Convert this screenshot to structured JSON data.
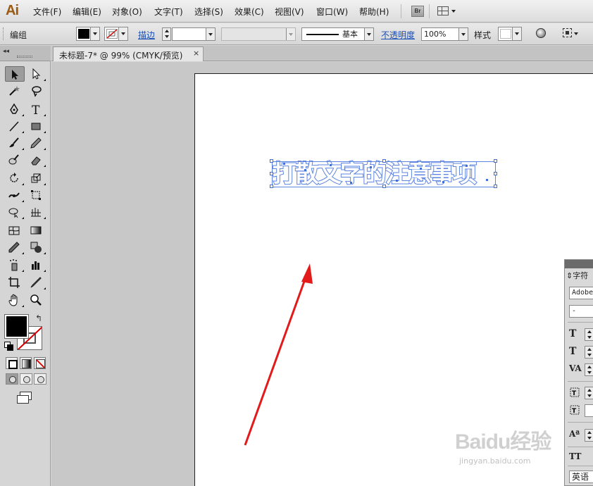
{
  "app": {
    "logo": "Ai",
    "menu": [
      "文件(F)",
      "编辑(E)",
      "对象(O)",
      "文字(T)",
      "选择(S)",
      "效果(C)",
      "视图(V)",
      "窗口(W)",
      "帮助(H)"
    ],
    "bridge_label": "Br"
  },
  "control_bar": {
    "selection_label": "编组",
    "fill_color": "#000000",
    "stroke_label": "描边",
    "stroke_weight": "",
    "stroke_profile": "基本",
    "opacity_label": "不透明度",
    "opacity_value": "100%",
    "style_label": "样式"
  },
  "document": {
    "tab_title": "未标题-7* @ 99% (CMYK/预览)",
    "close_glyph": "×",
    "text_object": "打散文字的注意事项",
    "selection_color": "#5d84e0",
    "arrow_color": "#e31a1a"
  },
  "toolbox": {
    "collapse_glyph": "◂◂",
    "tools": [
      "selection-tool",
      "direct-selection-tool",
      "magic-wand-tool",
      "lasso-tool",
      "pen-tool",
      "type-tool",
      "line-segment-tool",
      "rectangle-tool",
      "paintbrush-tool",
      "pencil-tool",
      "blob-brush-tool",
      "eraser-tool",
      "rotate-tool",
      "scale-tool",
      "width-tool",
      "free-transform-tool",
      "shape-builder-tool",
      "perspective-grid-tool",
      "mesh-tool",
      "gradient-tool",
      "eyedropper-tool",
      "blend-tool",
      "symbol-sprayer-tool",
      "column-graph-tool",
      "artboard-tool",
      "slice-tool",
      "hand-tool",
      "zoom-tool"
    ],
    "swap_glyph": "↰"
  },
  "character_panel": {
    "title": "字符",
    "font_family": "Adobe",
    "font_style": "-",
    "language": "英语",
    "icons": [
      "font-size-icon",
      "leading-icon",
      "kerning-icon",
      "horizontal-scale-icon",
      "vertical-scale-icon",
      "baseline-shift-icon",
      "all-caps-icon"
    ],
    "icon_glyphs": [
      "T",
      "T",
      "VA",
      "",
      "",
      "Aª",
      "TT"
    ]
  },
  "watermark": {
    "brand": "Baidu经验",
    "url": "jingyan.baidu.com"
  }
}
